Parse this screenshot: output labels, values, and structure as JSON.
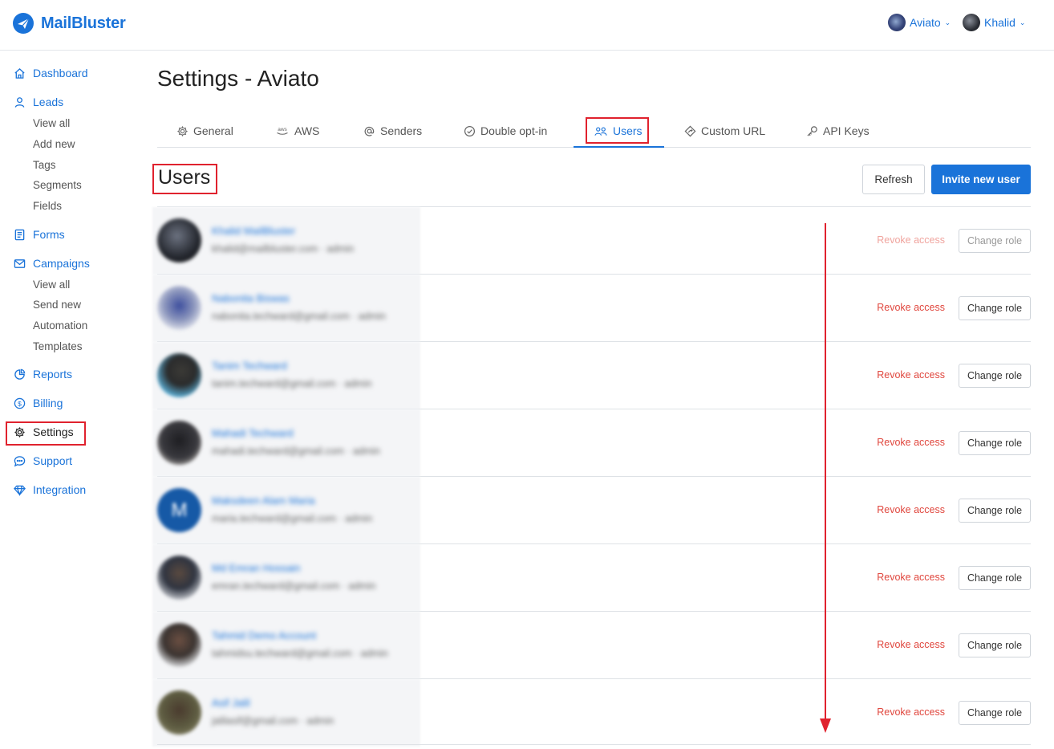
{
  "brand": {
    "name": "MailBluster",
    "color": "#1a73d9"
  },
  "header": {
    "organization": {
      "label": "Aviato"
    },
    "user": {
      "label": "Khalid"
    }
  },
  "sidebar": {
    "items": [
      {
        "label": "Dashboard",
        "icon": "home-icon"
      },
      {
        "label": "Leads",
        "icon": "user-icon",
        "children": [
          "View all",
          "Add new",
          "Tags",
          "Segments",
          "Fields"
        ]
      },
      {
        "label": "Forms",
        "icon": "form-icon"
      },
      {
        "label": "Campaigns",
        "icon": "envelope-icon",
        "children": [
          "View all",
          "Send new",
          "Automation",
          "Templates"
        ]
      },
      {
        "label": "Reports",
        "icon": "pie-chart-icon"
      },
      {
        "label": "Billing",
        "icon": "dollar-icon"
      },
      {
        "label": "Settings",
        "icon": "gear-icon",
        "active": true
      },
      {
        "label": "Support",
        "icon": "chat-icon"
      },
      {
        "label": "Integration",
        "icon": "diamond-icon"
      }
    ]
  },
  "page": {
    "title": "Settings - Aviato"
  },
  "tabs": [
    {
      "label": "General",
      "icon": "gear-icon"
    },
    {
      "label": "AWS",
      "icon": "aws-icon"
    },
    {
      "label": "Senders",
      "icon": "at-icon"
    },
    {
      "label": "Double opt-in",
      "icon": "check-circle-icon"
    },
    {
      "label": "Users",
      "icon": "users-icon",
      "active": true
    },
    {
      "label": "Custom URL",
      "icon": "link-diamond-icon"
    },
    {
      "label": "API Keys",
      "icon": "key-icon"
    }
  ],
  "users_section": {
    "title": "Users",
    "refresh_label": "Refresh",
    "invite_label": "Invite new user",
    "revoke_label": "Revoke access",
    "change_role_label": "Change role",
    "rows": [
      {
        "name": "Khalid MailBluster",
        "meta": "khalid@mailbluster.com · admin",
        "disabled": true
      },
      {
        "name": "Nabonita Biswas",
        "meta": "nabonita.techward@gmail.com · admin"
      },
      {
        "name": "Tanim Techward",
        "meta": "tanim.techward@gmail.com · admin"
      },
      {
        "name": "Mahadi Techward",
        "meta": "mahadi.techward@gmail.com · admin"
      },
      {
        "name": "Maksdeen Alam Maria",
        "meta": "maria.techward@gmail.com · admin"
      },
      {
        "name": "Md Emran Hossain",
        "meta": "emran.techward@gmail.com · admin"
      },
      {
        "name": "Tahmid Demo Account",
        "meta": "tahmidsu.techward@gmail.com · admin"
      },
      {
        "name": "Asif Jalil",
        "meta": "jalilasif@gmail.com · admin"
      }
    ]
  },
  "colors": {
    "accent": "#1a73d9",
    "danger": "#e0473e",
    "annotation": "#e0222e"
  }
}
